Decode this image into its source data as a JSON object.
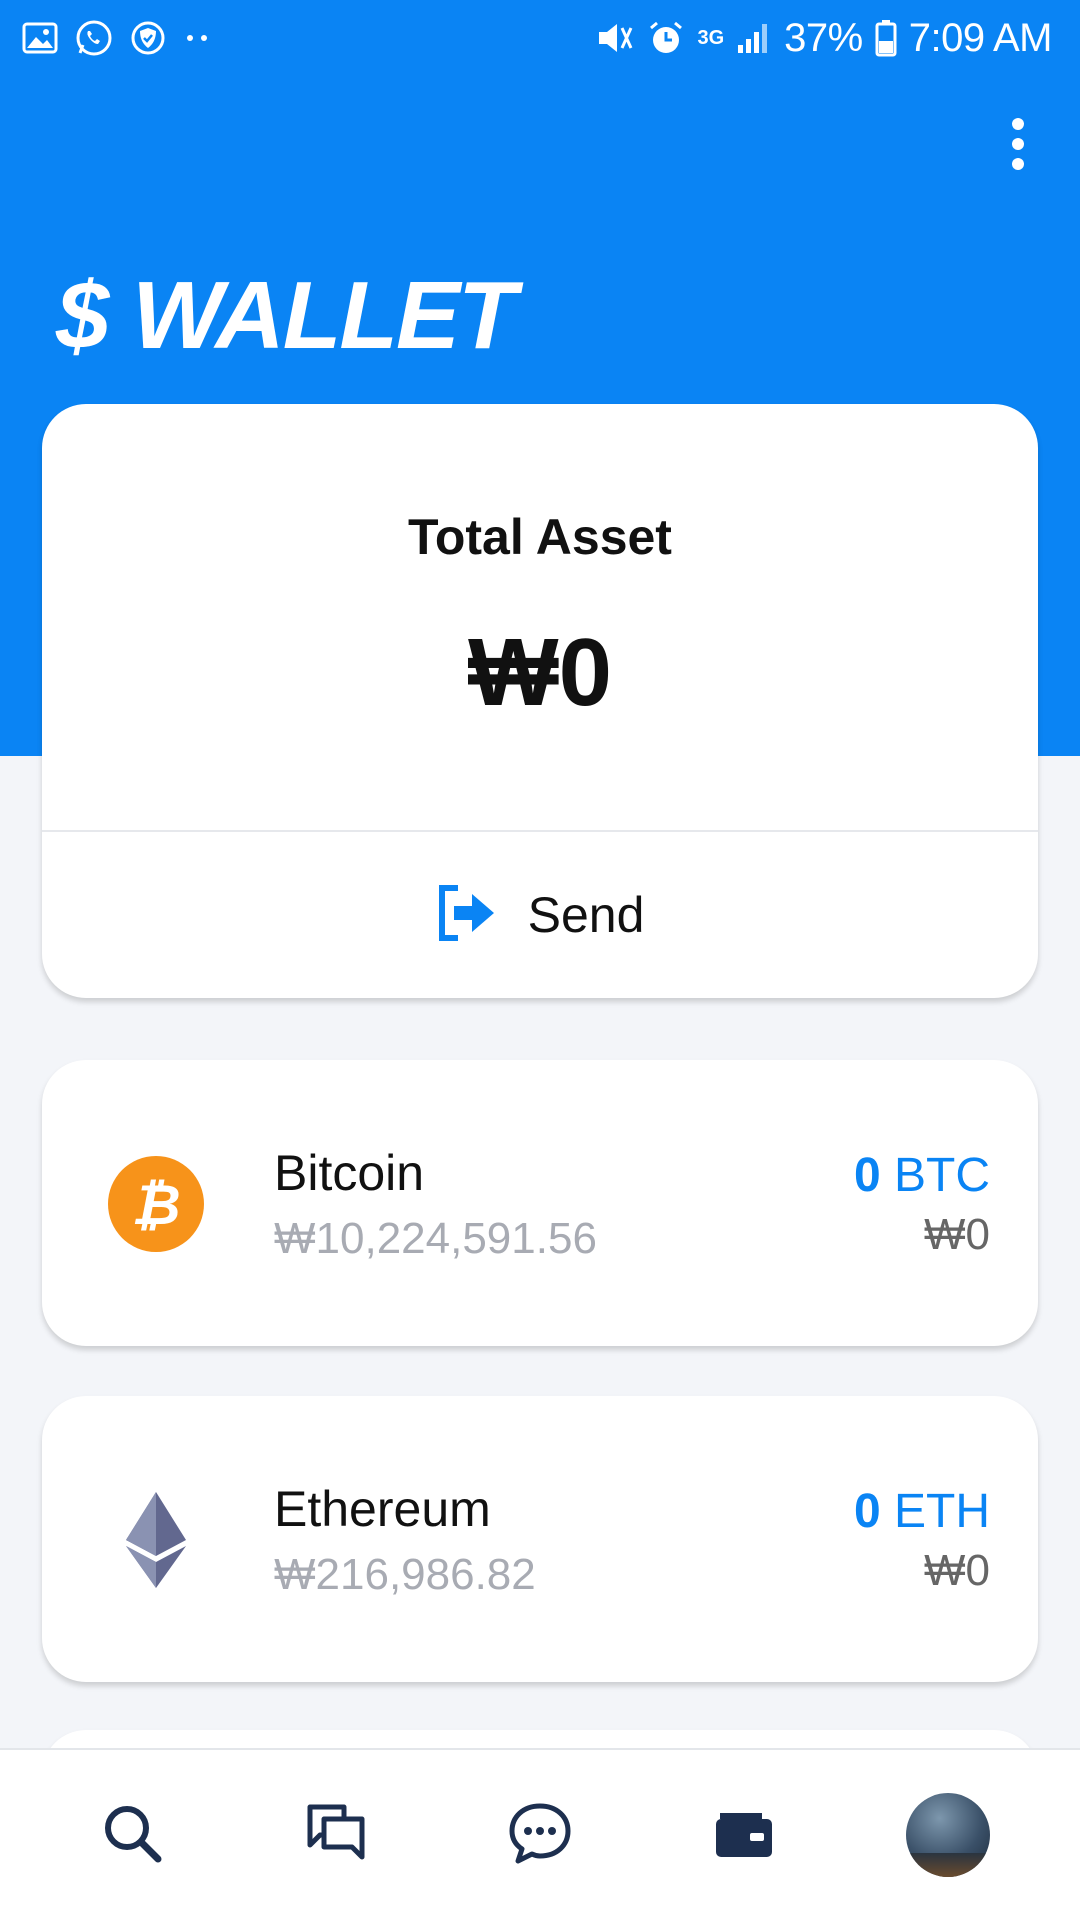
{
  "status_bar": {
    "battery": "37%",
    "time": "7:09 AM",
    "network": "3G"
  },
  "header": {
    "title": "$ WALLET"
  },
  "total": {
    "label": "Total Asset",
    "value": "₩0"
  },
  "send": {
    "label": "Send"
  },
  "assets": [
    {
      "name": "Bitcoin",
      "price": "₩10,224,591.56",
      "amount": "0",
      "unit": "BTC",
      "krw": "₩0",
      "icon": "bitcoin-icon"
    },
    {
      "name": "Ethereum",
      "price": "₩216,986.82",
      "amount": "0",
      "unit": "ETH",
      "krw": "₩0",
      "icon": "ethereum-icon"
    }
  ],
  "nav": [
    "search-icon",
    "chat-bubbles-icon",
    "message-icon",
    "wallet-icon",
    "profile-avatar"
  ],
  "colors": {
    "primary": "#0a84f4",
    "bitcoin": "#f7931a",
    "ethereum": "#627eea",
    "nav_icon": "#1d2f4f"
  }
}
